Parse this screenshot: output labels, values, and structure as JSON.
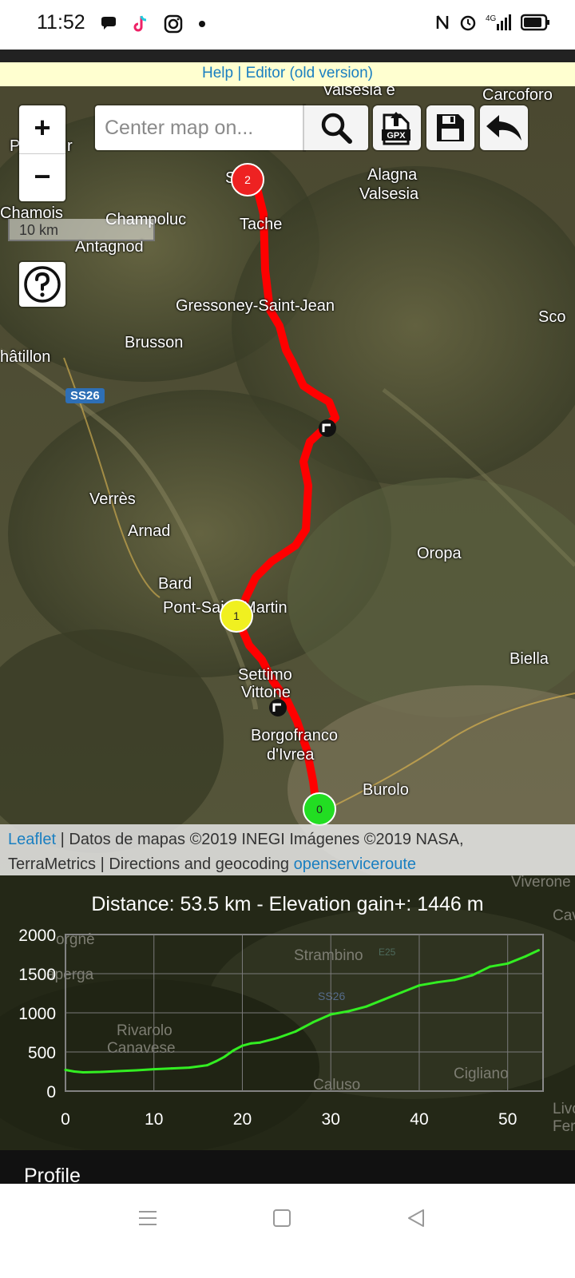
{
  "status_bar": {
    "time": "11:52",
    "network": "4G"
  },
  "help_bar": {
    "help_label": "Help",
    "separator": "|",
    "editor_label": "Editor (old version)"
  },
  "map": {
    "zoom_in": "+",
    "zoom_out": "−",
    "scale_label": "10 km",
    "search_placeholder": "Center map on...",
    "gpx_label": "GPX",
    "places": {
      "valsesia": "Valsesia e",
      "carcoforo": "Carcoforo",
      "alagna": "Alagna",
      "alagna2": "Valsesia",
      "chamois": "Chamois",
      "champoluc": "Champoluc",
      "antagnod": "Antagnod",
      "tache": "Tache",
      "gressoney": "Gressoney-Saint-Jean",
      "brusson": "Brusson",
      "chatillon": "hâtillon",
      "verres": "Verrès",
      "arnad": "Arnad",
      "bard": "Bard",
      "pontstmartin": "Pont-Saint-Martin",
      "oropa": "Oropa",
      "settimo": "Settimo",
      "vittone": "Vittone",
      "borgofranco": "Borgofranco",
      "divrea": "d'Ivrea",
      "burolo": "Burolo",
      "biella": "Biella",
      "sco": "Sco",
      "p": "P",
      "r": "r",
      "sal": "S    al"
    },
    "road_badge": "SS26",
    "markers": {
      "start": "0",
      "mid": "1",
      "end": "2"
    },
    "attribution": {
      "leaflet": "Leaflet",
      "text1": " | Datos de mapas ©2019 INEGI Imágenes ©2019 NASA,",
      "text2": "TerraMetrics | Directions and geocoding ",
      "ors": "openserviceroute"
    },
    "colors": {
      "route": "#ff0000",
      "start_marker": "#22dd22",
      "mid_marker": "#f0f020",
      "end_marker": "#ee2222"
    }
  },
  "profile": {
    "title": "Distance: 53.5 km  - Elevation gain+: 1446 m",
    "tab_label": "Profile",
    "bg_places": [
      "Strambino",
      "Rivarolo",
      "Canavese",
      "Caluso",
      "Cigliano",
      "Viverone",
      "Cav",
      "Livo",
      "Ferr",
      "orgnè",
      "aperga",
      "SS26",
      "E25"
    ]
  },
  "chart_data": {
    "type": "line",
    "title": "",
    "xlabel": "",
    "ylabel": "",
    "xlim": [
      0,
      54
    ],
    "ylim": [
      0,
      2000
    ],
    "xticks": [
      0,
      10,
      20,
      30,
      40,
      50
    ],
    "yticks": [
      0,
      500,
      1000,
      1500,
      2000
    ],
    "grid": true,
    "color": "#33ee22",
    "x": [
      0,
      1,
      2,
      4,
      6,
      8,
      10,
      12,
      14,
      16,
      17,
      18,
      19,
      20,
      21,
      22,
      24,
      26,
      28,
      30,
      32,
      34,
      36,
      38,
      40,
      42,
      44,
      46,
      48,
      50,
      52,
      53.5
    ],
    "y": [
      270,
      250,
      240,
      245,
      255,
      265,
      280,
      290,
      300,
      330,
      380,
      440,
      520,
      580,
      610,
      620,
      680,
      760,
      880,
      980,
      1020,
      1080,
      1170,
      1260,
      1350,
      1390,
      1420,
      1480,
      1590,
      1630,
      1720,
      1800
    ]
  }
}
